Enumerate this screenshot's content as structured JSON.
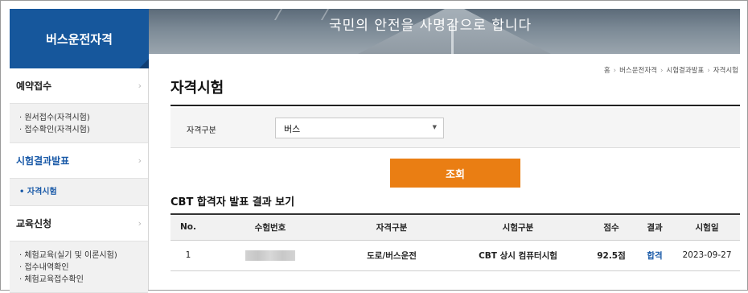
{
  "sidebar": {
    "title": "버스운전자격",
    "menu": [
      {
        "label": "예약접수",
        "chevron": "›",
        "sub": [
          "· 원서접수(자격시험)",
          "· 접수확인(자격시험)"
        ]
      },
      {
        "label": "시험결과발표",
        "chevron": "›",
        "sub": [
          "• 자격시험"
        ]
      },
      {
        "label": "교육신청",
        "chevron": "›",
        "sub": [
          "· 체험교육(실기 및 이론시험)",
          "· 접수내역확인",
          "· 체험교육접수확인"
        ]
      }
    ]
  },
  "banner": {
    "slogan": "국민의 안전을 사명감으로 합니다"
  },
  "breadcrumb": [
    "홈",
    "버스운전자격",
    "시험결과발표",
    "자격시험"
  ],
  "breadcrumb_sep": "›",
  "page_title": "자격시험",
  "filter": {
    "label": "자격구분",
    "selected": "버스",
    "caret": "▼"
  },
  "search_button": "조회",
  "result_title": "CBT 합격자 발표 결과 보기",
  "table": {
    "headers": [
      "No.",
      "수험번호",
      "자격구분",
      "시험구분",
      "점수",
      "결과",
      "시험일"
    ],
    "rows": [
      {
        "no": "1",
        "exam_number": "",
        "qualification": "도로/버스운전",
        "exam_type": "CBT 상시 컴퓨터시험",
        "score": "92.5점",
        "result": "합격",
        "date": "2023-09-27"
      }
    ]
  },
  "colors": {
    "brand": "#16579c",
    "accent": "#ea7e13",
    "link": "#1a5aa8"
  }
}
